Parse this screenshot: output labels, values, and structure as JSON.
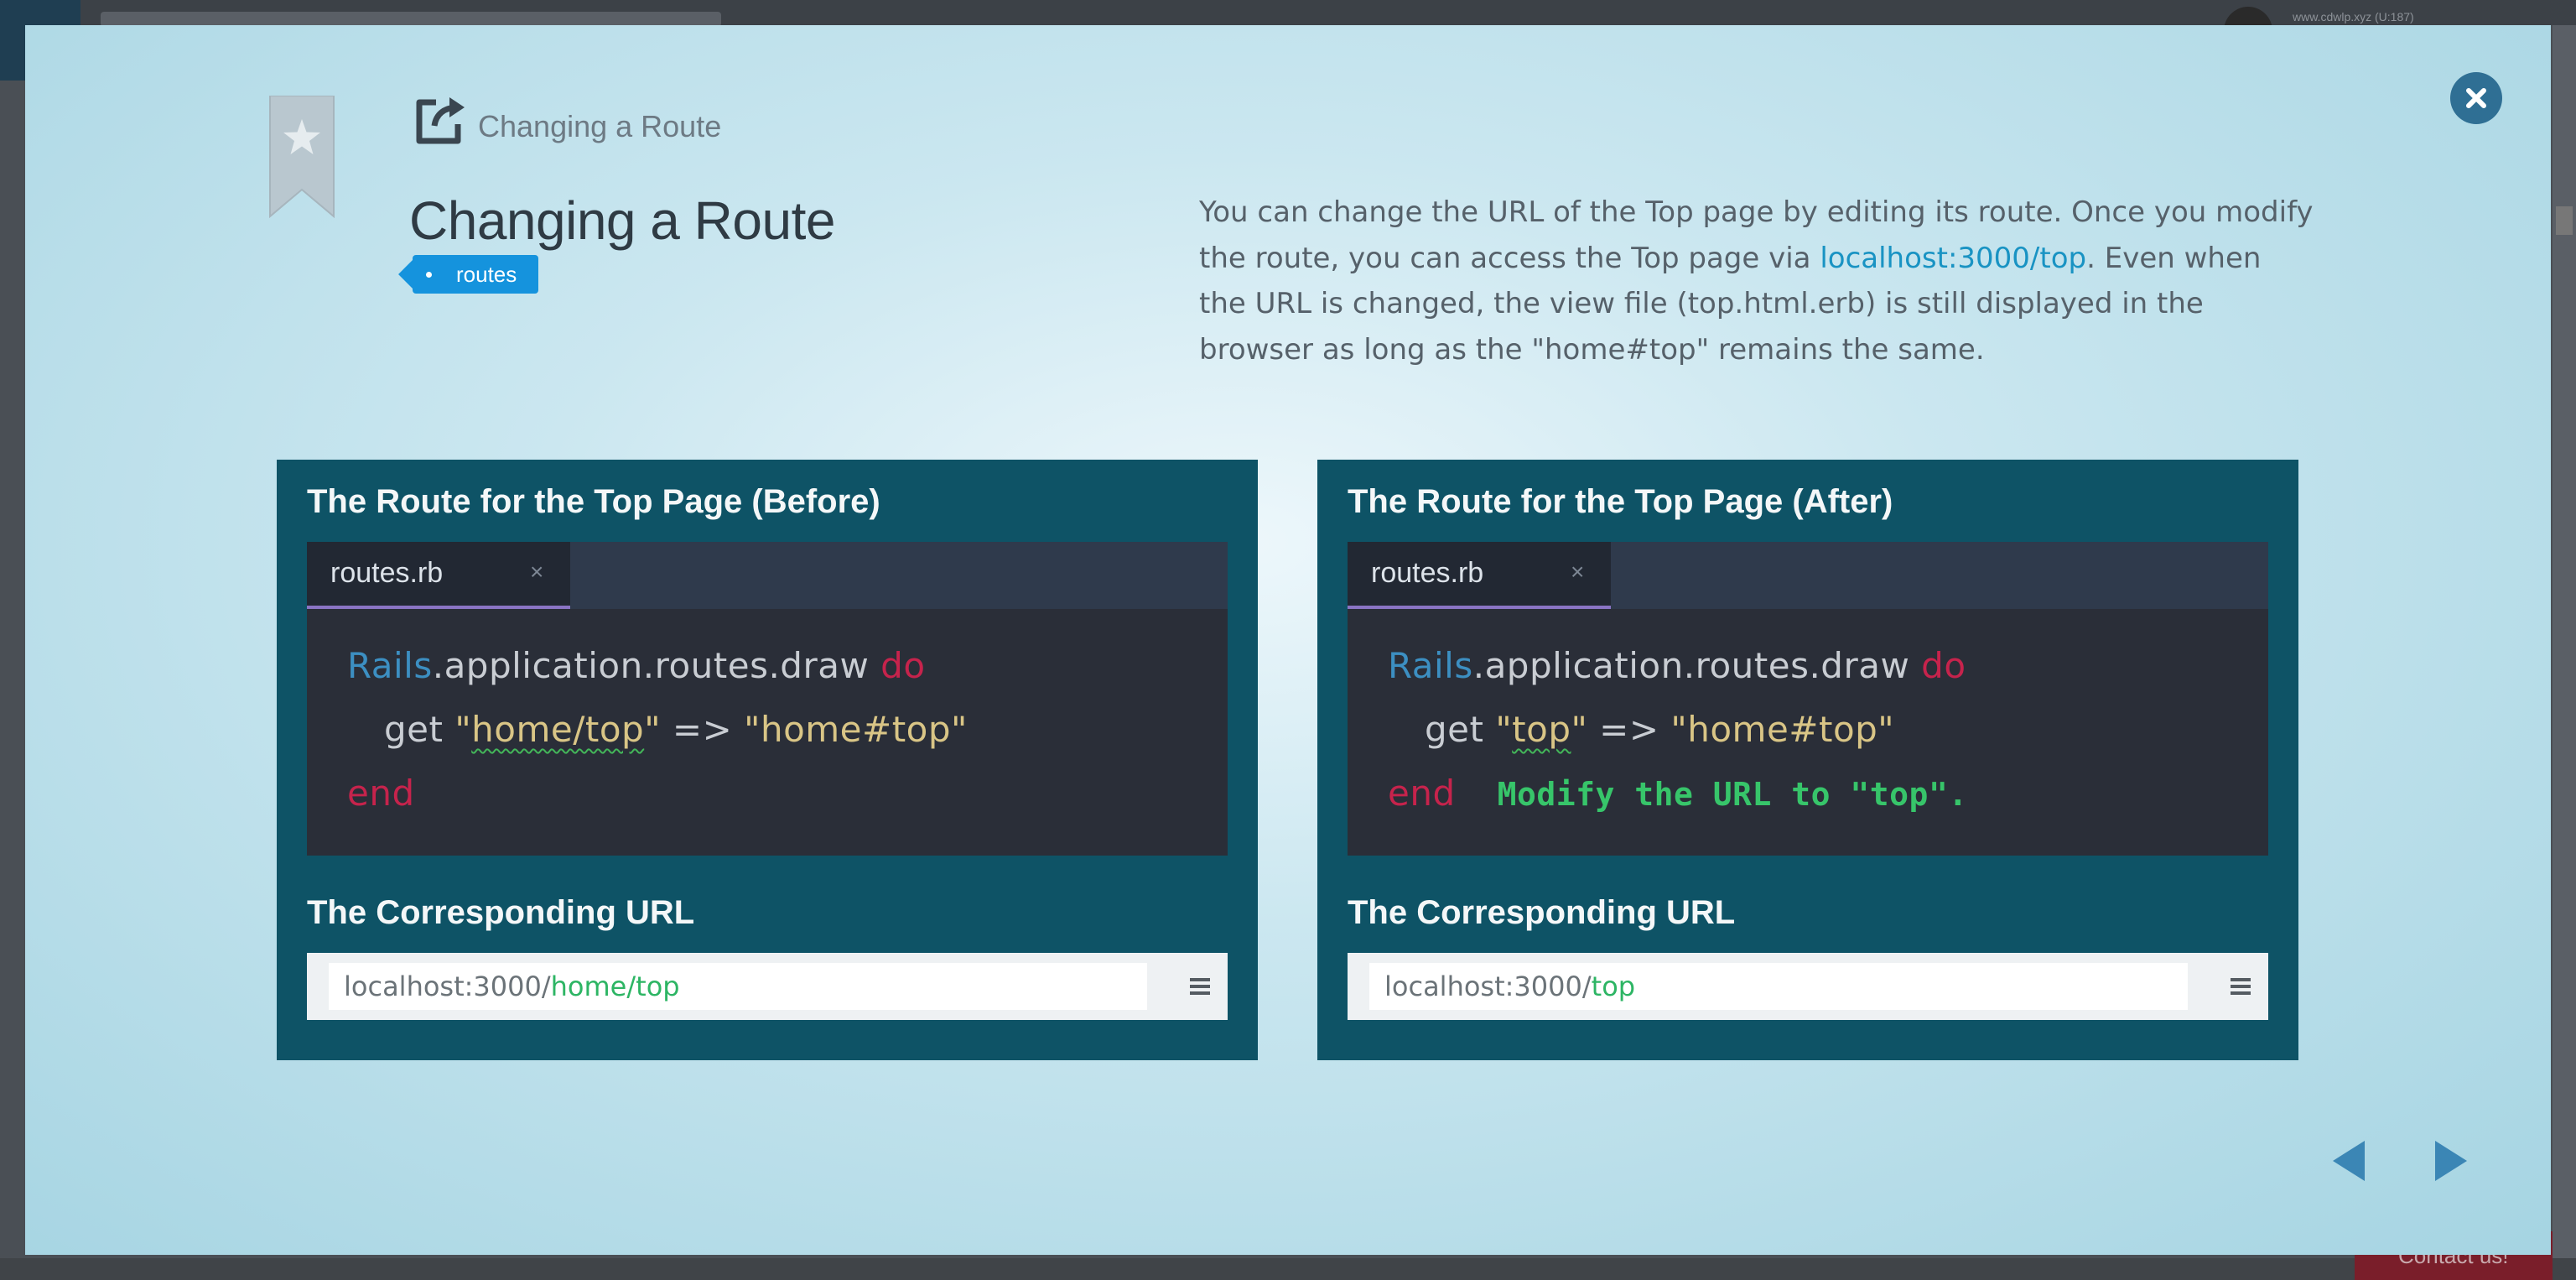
{
  "background": {
    "user_text": "www.cdwlp.xyz (U:187)",
    "contact_label": "Contact us!"
  },
  "modal": {
    "small_title": "Changing a Route",
    "title": "Changing a Route",
    "tag": "routes",
    "description": {
      "before_link": "You can change the URL of the Top page by editing its route. Once you modify the route, you can access the Top page via ",
      "link": "localhost:3000/top",
      "after_link": ". Even when the URL is changed, the view file (top.html.erb) is still displayed in the browser as long as the \"home#top\" remains the same."
    },
    "panels": [
      {
        "heading": "The Route for the Top Page (Before)",
        "file_tab": "routes.rb",
        "code": {
          "l1_obj": "Rails",
          "l1_chain": ".application.routes.draw ",
          "l1_kw": "do",
          "l2_get": "get ",
          "l2_path": "\"home/top\"",
          "l2_arrow": " => ",
          "l2_target": "\"home#top\"",
          "l3_end": "end",
          "annotation": ""
        },
        "url_heading": "The Corresponding URL",
        "url_host": "localhost:3000/",
        "url_path": "home/top"
      },
      {
        "heading": "The Route for the Top Page (After)",
        "file_tab": "routes.rb",
        "code": {
          "l1_obj": "Rails",
          "l1_chain": ".application.routes.draw ",
          "l1_kw": "do",
          "l2_get": "get ",
          "l2_path": "\"top\"",
          "l2_arrow": " => ",
          "l2_target": "\"home#top\"",
          "l3_end": "end",
          "annotation": "Modify the URL to \"top\"."
        },
        "url_heading": "The Corresponding URL",
        "url_host": "localhost:3000/",
        "url_path": "top"
      }
    ],
    "tab_close_glyph": "×",
    "icons": {
      "close": "close-icon",
      "bookmark": "bookmark-star-icon",
      "external": "external-link-icon",
      "menu": "menu-icon",
      "prev": "prev-arrow-icon",
      "next": "next-arrow-icon"
    },
    "colors": {
      "panel_bg": "#0e5366",
      "tag_bg": "#1593dd",
      "link": "#1993c3",
      "url_path": "#2db564",
      "close_bg": "#2f6f94"
    }
  }
}
